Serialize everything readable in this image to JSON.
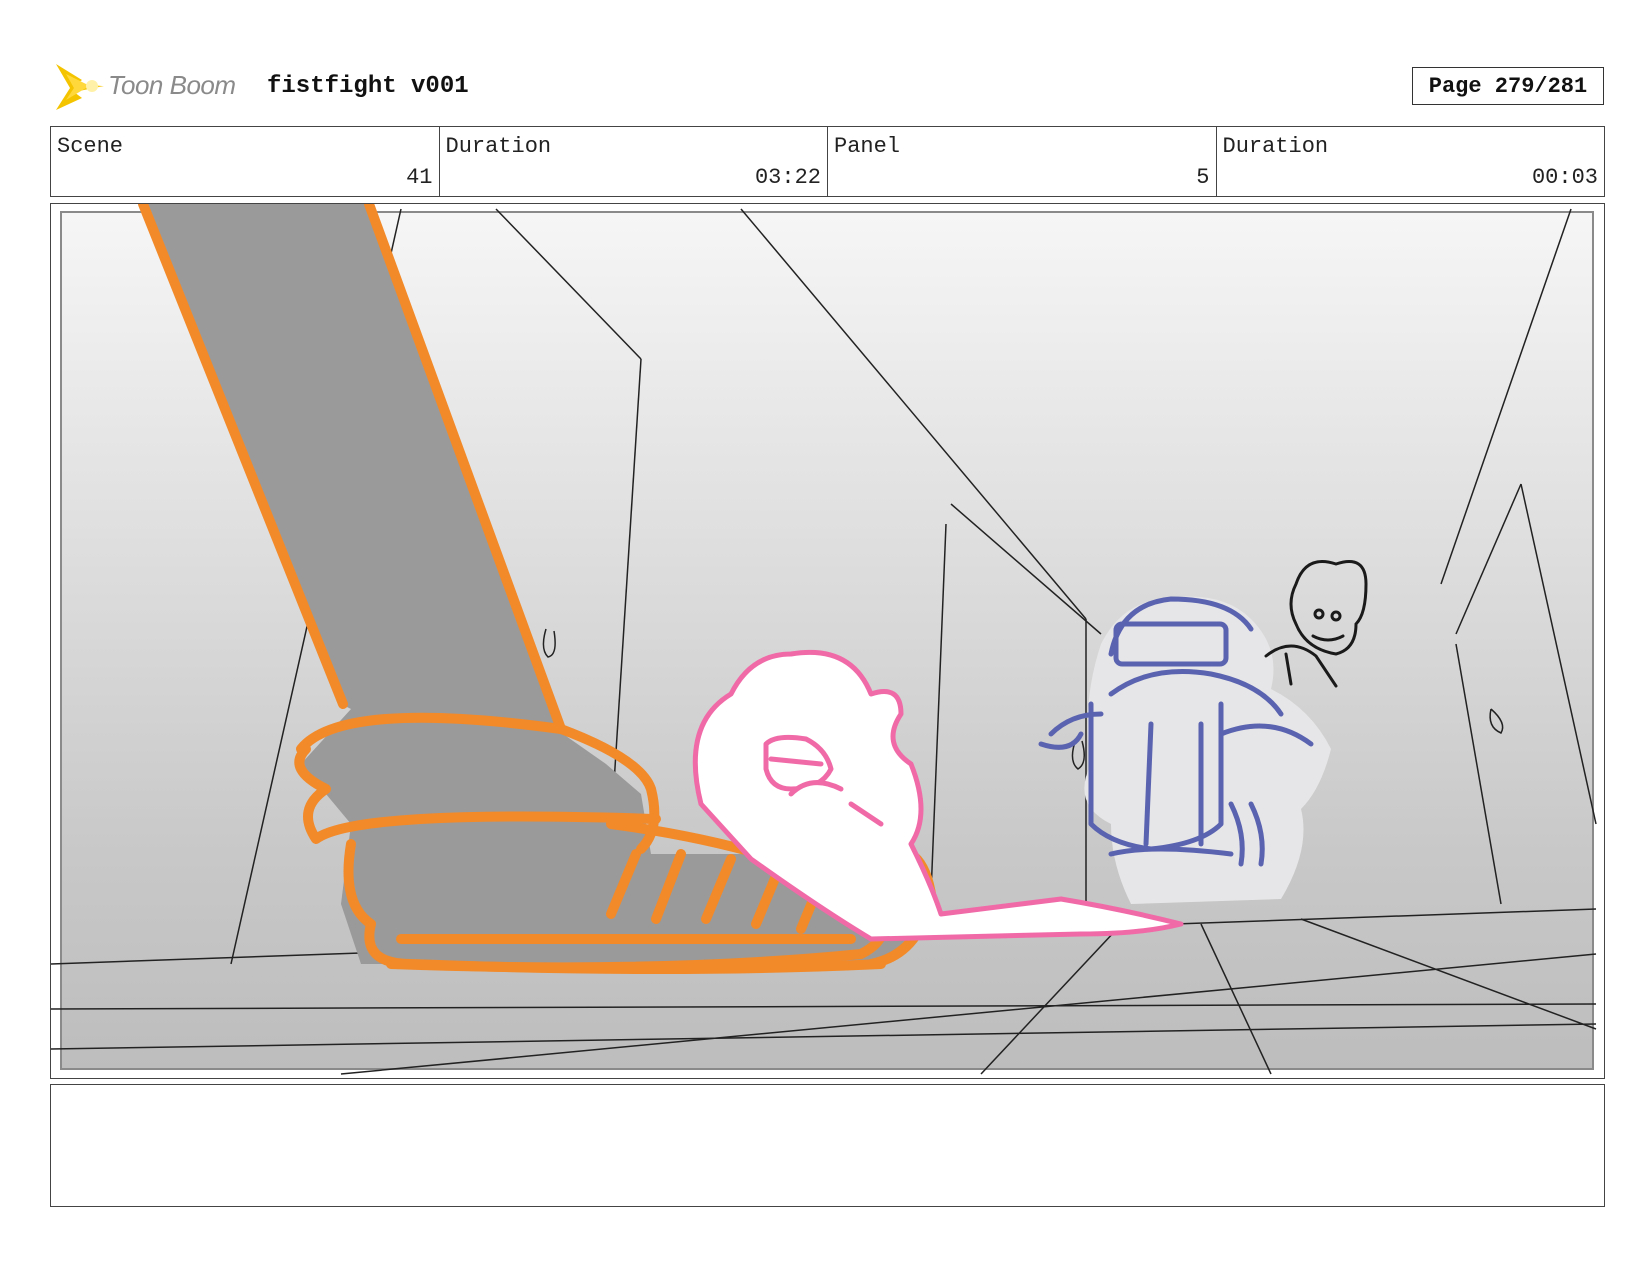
{
  "header": {
    "logo_text": "Toon Boom",
    "project_title": "fistfight v001",
    "page_label": "Page 279/281"
  },
  "info": {
    "scene_label": "Scene",
    "scene_value": "41",
    "scene_duration_label": "Duration",
    "scene_duration_value": "03:22",
    "panel_label": "Panel",
    "panel_value": "5",
    "panel_duration_label": "Duration",
    "panel_duration_value": "00:03"
  },
  "notes": {
    "text": ""
  },
  "colors": {
    "logo_yellow": "#f5c400",
    "leg_orange": "#f28a2a",
    "leg_fill": "#9a9a9a",
    "pink_character": "#f06aa8",
    "blue_character": "#5a63b0",
    "sketch_line": "#222222"
  }
}
